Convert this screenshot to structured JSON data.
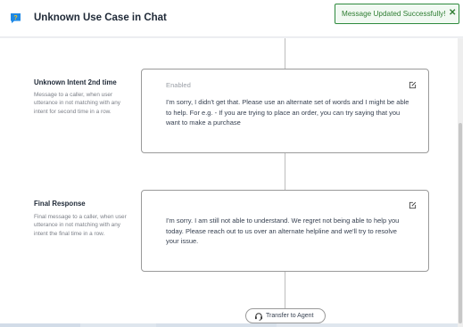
{
  "header": {
    "title": "Unknown Use Case in Chat",
    "icon": "chat-question-icon"
  },
  "toast": {
    "message": "Message Updated Successfully!",
    "close_glyph": "✕",
    "color": "#2e7d32"
  },
  "sections": [
    {
      "title": "Unknown Intent 2nd time",
      "description": "Message to a caller, when user utterance in not matching with any intent for second time in a row.",
      "status": "Enabled",
      "message": "I'm sorry, I didn't get that. Please use an alternate set of words and I might be able to help. For e.g. - If you are trying to place an order, you can try saying that you want to make a purchase"
    },
    {
      "title": "Final Response",
      "description": "Final message to a caller, when user utterance in not matching with any intent the final time in a row.",
      "message": "I'm sorry. I am still not able to understand. We regret not being able to help you today. Please reach out to us over an alternate helpline and we'll try to resolve your issue."
    }
  ],
  "transfer_button": {
    "label": "Transfer to Agent",
    "icon": "headset-icon"
  },
  "colors": {
    "accent": "#2e7d32",
    "card_border": "#9a9a9a",
    "icon_blue": "#1e88e5"
  }
}
